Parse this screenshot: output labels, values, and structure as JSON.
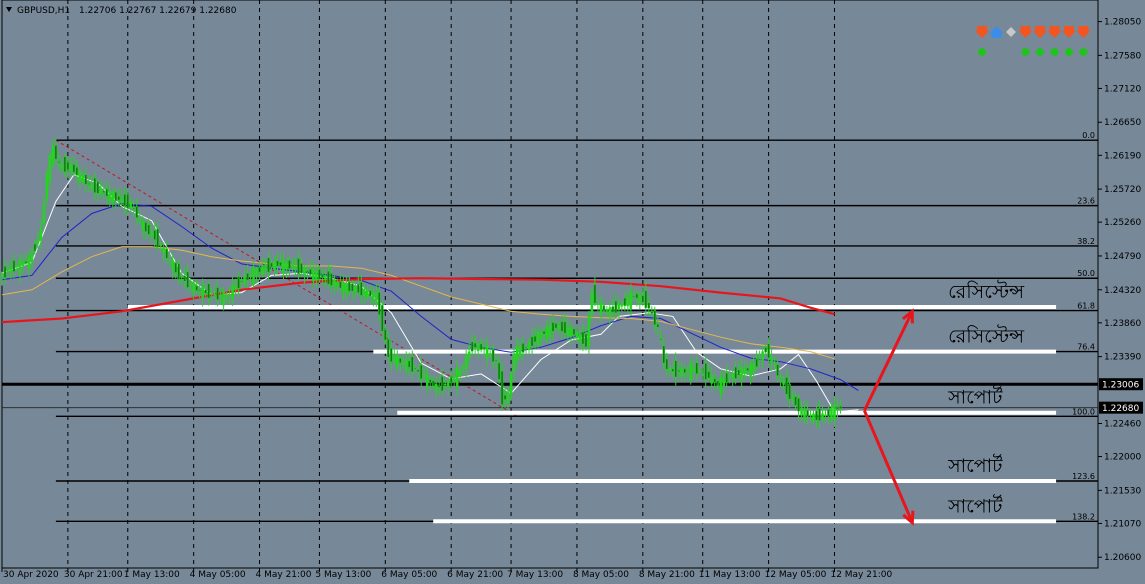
{
  "header": {
    "symbol": "GBPUSD,H1",
    "ohlc": "1.22706 1.22767 1.22679 1.22680"
  },
  "chart_data": {
    "type": "candlestick",
    "symbol": "GBPUSD",
    "timeframe": "H1",
    "ylim": [
      1.2045,
      1.2835
    ],
    "y_ticks": [
      "1.28050",
      "1.27580",
      "1.27120",
      "1.26650",
      "1.26190",
      "1.25720",
      "1.25260",
      "1.24790",
      "1.24320",
      "1.23860",
      "1.23390",
      "1.22460",
      "1.22000",
      "1.21530",
      "1.21070",
      "1.20600"
    ],
    "x_ticks": [
      "30 Apr 2020",
      "30 Apr 21:00",
      "1 May 13:00",
      "4 May 05:00",
      "4 May 21:00",
      "5 May 13:00",
      "6 May 05:00",
      "6 May 21:00",
      "7 May 13:00",
      "8 May 05:00",
      "8 May 21:00",
      "11 May 13:00",
      "12 May 05:00",
      "12 May 21:00"
    ],
    "x_tick_index": [
      0,
      11,
      21,
      32,
      43,
      53,
      64,
      75,
      85,
      96,
      107,
      117,
      128,
      139
    ],
    "x_max_index": 183,
    "price_labels": [
      {
        "value": 1.23006,
        "text": "1.23006",
        "line": "black"
      },
      {
        "value": 1.2268,
        "text": "1.22680",
        "line": "current"
      }
    ],
    "fibonacci": {
      "levels": [
        {
          "ratio": "0.0",
          "price": 1.264
        },
        {
          "ratio": "23.6",
          "price": 1.2549
        },
        {
          "ratio": "38.2",
          "price": 1.2493
        },
        {
          "ratio": "50.0",
          "price": 1.2448
        },
        {
          "ratio": "61.8",
          "price": 1.2403
        },
        {
          "ratio": "76.4",
          "price": 1.2346
        },
        {
          "ratio": "100.0",
          "price": 1.2256
        },
        {
          "ratio": "123.6",
          "price": 1.2166
        },
        {
          "ratio": "138.2",
          "price": 1.211
        }
      ],
      "start_index": 9,
      "trend_from": {
        "index": 9,
        "price": 1.264
      },
      "trend_to": {
        "index": 86,
        "price": 1.2256
      }
    },
    "zones": [
      {
        "label": "রেসিস্টেন্স",
        "price": 1.2408,
        "from_index": 21,
        "to_index": 176
      },
      {
        "label": "রেসিস্টেন্স",
        "price": 1.2346,
        "from_index": 62,
        "to_index": 176
      },
      {
        "label": "সাপোর্ট",
        "price": 1.2261,
        "from_index": 66,
        "to_index": 176
      },
      {
        "label": "সাপোর্ট",
        "price": 1.2166,
        "from_index": 68,
        "to_index": 176
      },
      {
        "label": "সাপোর্ট",
        "price": 1.211,
        "from_index": 72,
        "to_index": 176
      }
    ],
    "arrows": [
      {
        "from": {
          "index": 144,
          "price": 1.2264
        },
        "to": {
          "index": 152,
          "price": 1.2402
        }
      },
      {
        "from": {
          "index": 144,
          "price": 1.2264
        },
        "to": {
          "index": 152,
          "price": 1.2108
        }
      }
    ],
    "series": [
      {
        "kind": "ma",
        "color": "#FFFFFF",
        "points": [
          [
            0,
            1.2455
          ],
          [
            5,
            1.247
          ],
          [
            9,
            1.2555
          ],
          [
            12,
            1.2592
          ],
          [
            16,
            1.258
          ],
          [
            20,
            1.2548
          ],
          [
            25,
            1.2528
          ],
          [
            30,
            1.2455
          ],
          [
            35,
            1.2425
          ],
          [
            40,
            1.2428
          ],
          [
            45,
            1.2452
          ],
          [
            50,
            1.2455
          ],
          [
            55,
            1.2448
          ],
          [
            60,
            1.2437
          ],
          [
            65,
            1.24
          ],
          [
            70,
            1.233
          ],
          [
            75,
            1.2308
          ],
          [
            80,
            1.2315
          ],
          [
            85,
            1.2288
          ],
          [
            90,
            1.2335
          ],
          [
            95,
            1.2362
          ],
          [
            100,
            1.237
          ],
          [
            103,
            1.2395
          ],
          [
            108,
            1.24
          ],
          [
            112,
            1.2395
          ],
          [
            116,
            1.2345
          ],
          [
            120,
            1.2322
          ],
          [
            125,
            1.2312
          ],
          [
            130,
            1.2322
          ],
          [
            133,
            1.2342
          ],
          [
            136,
            1.2305
          ],
          [
            139,
            1.2262
          ],
          [
            143,
            1.2265
          ]
        ]
      },
      {
        "kind": "ma",
        "color": "#1E22C8",
        "points": [
          [
            0,
            1.2446
          ],
          [
            5,
            1.2452
          ],
          [
            10,
            1.2505
          ],
          [
            15,
            1.2538
          ],
          [
            20,
            1.2552
          ],
          [
            25,
            1.2548
          ],
          [
            30,
            1.252
          ],
          [
            35,
            1.249
          ],
          [
            40,
            1.2468
          ],
          [
            45,
            1.2462
          ],
          [
            50,
            1.2457
          ],
          [
            55,
            1.2452
          ],
          [
            60,
            1.2445
          ],
          [
            65,
            1.243
          ],
          [
            70,
            1.2395
          ],
          [
            75,
            1.2363
          ],
          [
            80,
            1.2352
          ],
          [
            85,
            1.2345
          ],
          [
            90,
            1.2352
          ],
          [
            95,
            1.2365
          ],
          [
            100,
            1.2382
          ],
          [
            105,
            1.2395
          ],
          [
            110,
            1.2392
          ],
          [
            115,
            1.2372
          ],
          [
            120,
            1.2352
          ],
          [
            125,
            1.2337
          ],
          [
            130,
            1.2332
          ],
          [
            135,
            1.2322
          ],
          [
            140,
            1.2307
          ],
          [
            143,
            1.2292
          ]
        ]
      },
      {
        "kind": "ma",
        "color": "#E6B84A",
        "points": [
          [
            0,
            1.2425
          ],
          [
            5,
            1.2432
          ],
          [
            10,
            1.2457
          ],
          [
            15,
            1.2478
          ],
          [
            20,
            1.2492
          ],
          [
            25,
            1.2492
          ],
          [
            30,
            1.2487
          ],
          [
            35,
            1.2478
          ],
          [
            40,
            1.2472
          ],
          [
            45,
            1.2468
          ],
          [
            50,
            1.2465
          ],
          [
            55,
            1.2465
          ],
          [
            60,
            1.2462
          ],
          [
            65,
            1.2452
          ],
          [
            70,
            1.2437
          ],
          [
            75,
            1.2422
          ],
          [
            80,
            1.2412
          ],
          [
            85,
            1.2402
          ],
          [
            90,
            1.2398
          ],
          [
            95,
            1.2395
          ],
          [
            100,
            1.2393
          ],
          [
            105,
            1.2392
          ],
          [
            110,
            1.2388
          ],
          [
            115,
            1.2377
          ],
          [
            120,
            1.2366
          ],
          [
            125,
            1.2357
          ],
          [
            130,
            1.2352
          ],
          [
            135,
            1.2346
          ],
          [
            139,
            1.2336
          ]
        ]
      },
      {
        "kind": "ma",
        "color": "#E8161C",
        "points": [
          [
            0,
            1.2387
          ],
          [
            10,
            1.2392
          ],
          [
            20,
            1.2402
          ],
          [
            30,
            1.2417
          ],
          [
            40,
            1.2432
          ],
          [
            50,
            1.2442
          ],
          [
            60,
            1.2447
          ],
          [
            70,
            1.2448
          ],
          [
            80,
            1.2447
          ],
          [
            90,
            1.2446
          ],
          [
            100,
            1.2443
          ],
          [
            110,
            1.2437
          ],
          [
            120,
            1.2428
          ],
          [
            130,
            1.242
          ],
          [
            135,
            1.2407
          ],
          [
            139,
            1.2398
          ]
        ]
      }
    ],
    "price_path": [
      [
        0,
        1.245
      ],
      [
        2,
        1.2462
      ],
      [
        5,
        1.2472
      ],
      [
        7,
        1.2515
      ],
      [
        8,
        1.2595
      ],
      [
        9,
        1.2628
      ],
      [
        10,
        1.2605
      ],
      [
        12,
        1.2602
      ],
      [
        15,
        1.2578
      ],
      [
        18,
        1.2565
      ],
      [
        20,
        1.2558
      ],
      [
        22,
        1.255
      ],
      [
        24,
        1.252
      ],
      [
        26,
        1.2505
      ],
      [
        28,
        1.2478
      ],
      [
        30,
        1.2452
      ],
      [
        33,
        1.2432
      ],
      [
        36,
        1.2425
      ],
      [
        38,
        1.2422
      ],
      [
        40,
        1.2442
      ],
      [
        43,
        1.2458
      ],
      [
        46,
        1.2468
      ],
      [
        49,
        1.2465
      ],
      [
        51,
        1.2458
      ],
      [
        54,
        1.245
      ],
      [
        57,
        1.2437
      ],
      [
        60,
        1.2432
      ],
      [
        63,
        1.2422
      ],
      [
        64,
        1.238
      ],
      [
        65,
        1.234
      ],
      [
        67,
        1.2332
      ],
      [
        69,
        1.2325
      ],
      [
        71,
        1.231
      ],
      [
        73,
        1.2296
      ],
      [
        75,
        1.2303
      ],
      [
        77,
        1.2318
      ],
      [
        79,
        1.2355
      ],
      [
        81,
        1.235
      ],
      [
        83,
        1.2332
      ],
      [
        84,
        1.228
      ],
      [
        85,
        1.2285
      ],
      [
        86,
        1.2345
      ],
      [
        88,
        1.2352
      ],
      [
        90,
        1.2368
      ],
      [
        93,
        1.2382
      ],
      [
        96,
        1.2372
      ],
      [
        98,
        1.2358
      ],
      [
        99,
        1.243
      ],
      [
        100,
        1.2408
      ],
      [
        102,
        1.2402
      ],
      [
        104,
        1.2412
      ],
      [
        106,
        1.2424
      ],
      [
        108,
        1.2415
      ],
      [
        110,
        1.2378
      ],
      [
        111,
        1.233
      ],
      [
        112,
        1.232
      ],
      [
        114,
        1.2318
      ],
      [
        116,
        1.2322
      ],
      [
        118,
        1.2315
      ],
      [
        120,
        1.23
      ],
      [
        122,
        1.2312
      ],
      [
        124,
        1.2318
      ],
      [
        126,
        1.2325
      ],
      [
        128,
        1.235
      ],
      [
        130,
        1.2315
      ],
      [
        132,
        1.2285
      ],
      [
        134,
        1.2262
      ],
      [
        136,
        1.2255
      ],
      [
        138,
        1.2258
      ],
      [
        140,
        1.2268
      ]
    ],
    "indicator_panel": {
      "arrows": [
        "down",
        "up",
        "neutral",
        "down",
        "down",
        "down",
        "down",
        "down"
      ],
      "dots": [
        true,
        false,
        false,
        true,
        true,
        true,
        true,
        true
      ]
    }
  }
}
